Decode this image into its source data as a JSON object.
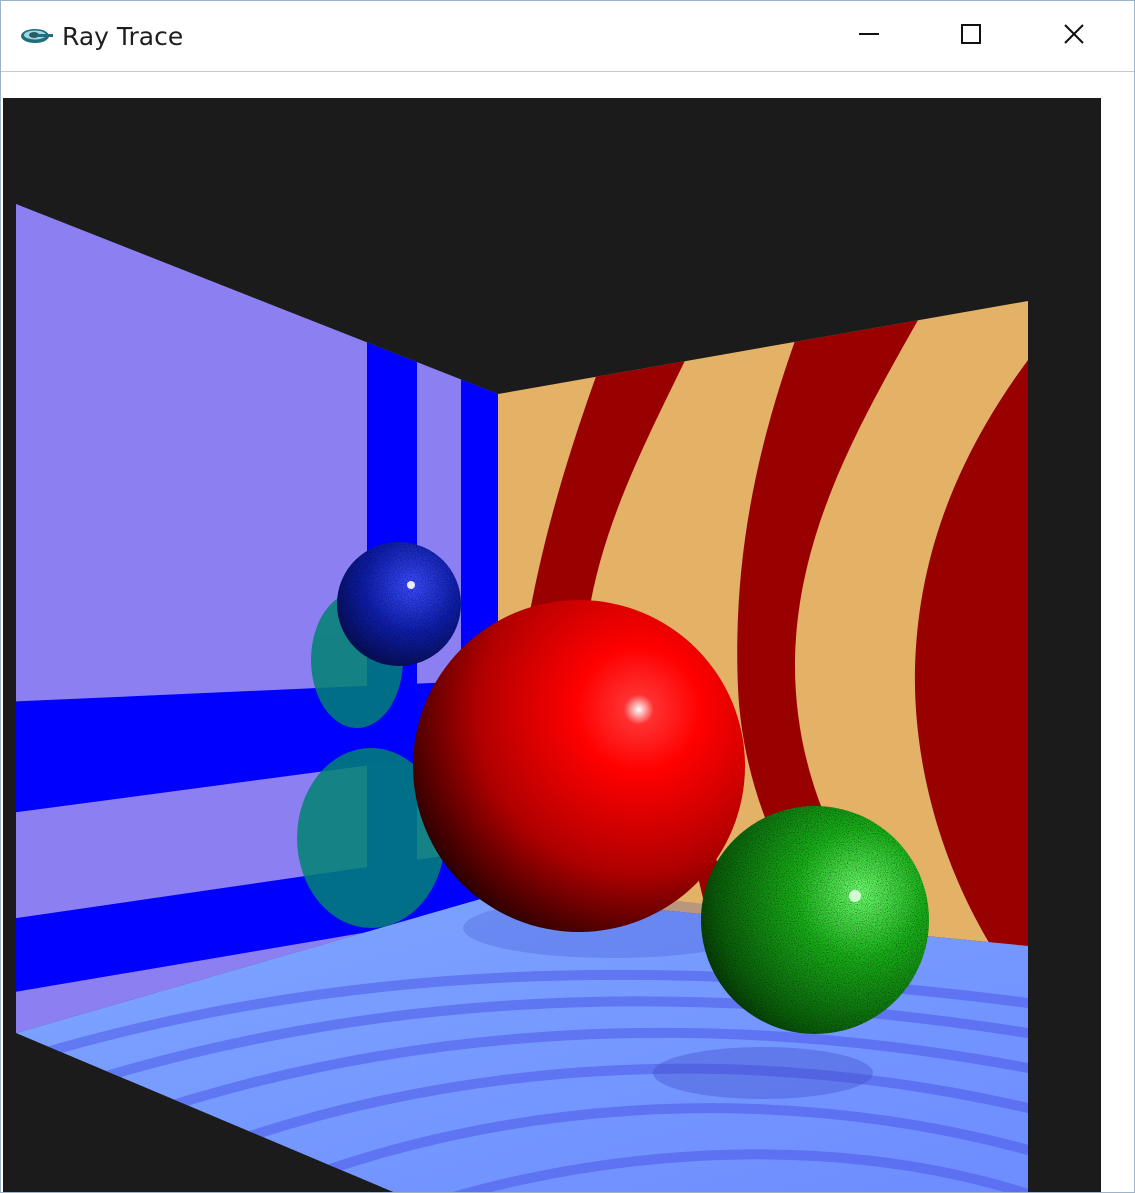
{
  "window": {
    "title": "Ray Trace",
    "icon": "app-logo-icon",
    "controls": {
      "minimize": "minimize-icon",
      "maximize": "maximize-icon",
      "close": "close-icon"
    }
  },
  "scene": {
    "background_color": "#1b1b1b",
    "left_wall": {
      "base_color": "#8c7ff2",
      "stripe_color": "#0000fe",
      "reflection_color": "#008272"
    },
    "back_wall": {
      "color_a": "#990000",
      "color_b": "#e3b267"
    },
    "floor": {
      "light_color": "#7fa6ff",
      "dark_color": "#4e59e8"
    },
    "spheres": [
      {
        "name": "blue-sphere",
        "color": "#0a1c9c"
      },
      {
        "name": "red-sphere",
        "color": "#ff0000"
      },
      {
        "name": "green-sphere",
        "color": "#17a417"
      }
    ]
  }
}
